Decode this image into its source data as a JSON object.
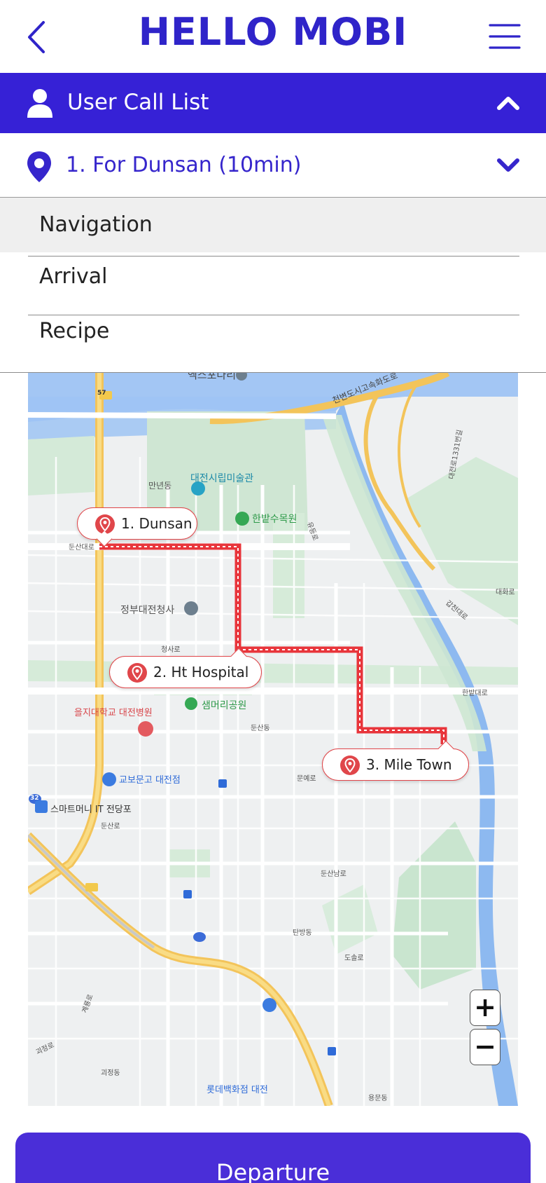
{
  "header": {
    "app_title": "HELLO MOBI",
    "back_icon": "chevron-left-icon",
    "menu_icon": "hamburger-menu-icon"
  },
  "call_list": {
    "title": "User Call List",
    "icon": "user-icon",
    "toggle_icon": "chevron-up-icon",
    "background_color": "#3621d6"
  },
  "destination": {
    "label": "1. For Dunsan (10min)",
    "icon": "location-pin-icon",
    "toggle_icon": "chevron-down-icon",
    "accent_color": "#3626cc"
  },
  "menu": {
    "items": [
      {
        "label": "Navigation",
        "active": true
      },
      {
        "label": "Arrival",
        "active": false
      },
      {
        "label": "Recipe",
        "active": false
      }
    ]
  },
  "map": {
    "stops": [
      {
        "label": "1. Dunsan"
      },
      {
        "label": "2. Ht Hospital"
      },
      {
        "label": "3. Mile Town"
      }
    ],
    "route_color": "#e8353b",
    "places": [
      {
        "name": "엑스포다리"
      },
      {
        "name": "대전시립미술관"
      },
      {
        "name": "한밭수목원"
      },
      {
        "name": "정부대전청사"
      },
      {
        "name": "샘머리공원"
      },
      {
        "name": "을지대학교 대전병원"
      },
      {
        "name": "교보문고 대전점"
      },
      {
        "name": "스마트머니 IT 전당포"
      },
      {
        "name": "롯데백화점 대전"
      }
    ],
    "road_labels": [
      {
        "name": "천변도시고속화도로"
      },
      {
        "name": "만년동"
      },
      {
        "name": "둔산대로"
      },
      {
        "name": "청사로"
      },
      {
        "name": "둔산동"
      },
      {
        "name": "둔산로"
      },
      {
        "name": "문예로"
      },
      {
        "name": "둔산남로"
      },
      {
        "name": "탄방동"
      },
      {
        "name": "도솔로"
      },
      {
        "name": "괴정동"
      },
      {
        "name": "용문동"
      },
      {
        "name": "한밭대로"
      },
      {
        "name": "대화로"
      },
      {
        "name": "갑천대로"
      },
      {
        "name": "대전로1331번길"
      },
      {
        "name": "계룡로"
      },
      {
        "name": "유등로"
      },
      {
        "name": "괴정로"
      }
    ],
    "route_shields": [
      {
        "number": "57"
      },
      {
        "number": "32"
      }
    ],
    "zoom_in_label": "+",
    "zoom_out_label": "−"
  },
  "footer": {
    "departure_label": "Departure",
    "button_color": "#4a2ed8"
  }
}
